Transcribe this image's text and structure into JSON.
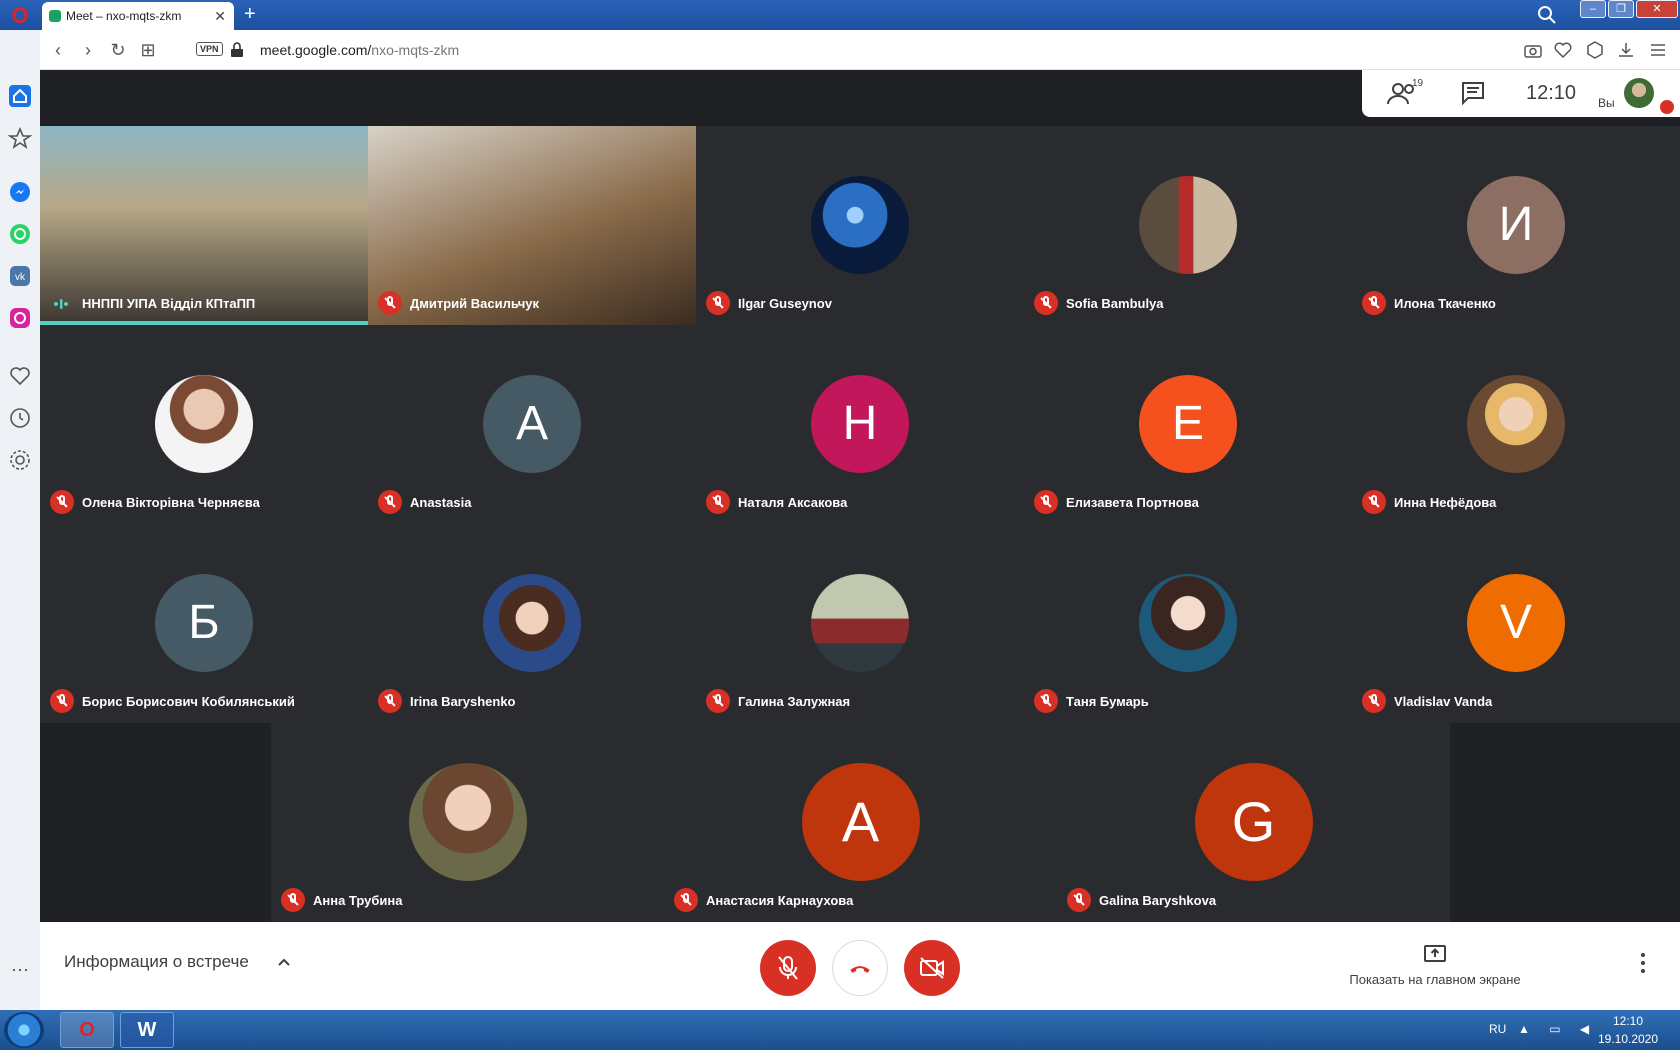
{
  "browser": {
    "tab_title": "Meet – nxo-mqts-zkm",
    "vpn_label": "VPN",
    "url_host": "meet.google.com/",
    "url_path": "nxo-mqts-zkm"
  },
  "meet": {
    "participant_count": "19",
    "time": "12:10",
    "you_label": "Вы",
    "meeting_info": "Информация о встрече",
    "present_label": "Показать на главном экране"
  },
  "participants": [
    {
      "name": "ННППІ УІПА Відділ КПтаПП",
      "type": "video"
    },
    {
      "name": "Дмитрий Васильчук",
      "type": "video"
    },
    {
      "name": "Ilgar Guseynov",
      "type": "photo"
    },
    {
      "name": "Sofia Bambulya",
      "type": "photo"
    },
    {
      "name": "Илона Ткаченко",
      "type": "initial",
      "initial": "И",
      "color": "#8d6e63"
    },
    {
      "name": "Олена Вікторівна Черняєва",
      "type": "photo"
    },
    {
      "name": "Anastasia",
      "type": "initial",
      "initial": "A",
      "color": "#455a64"
    },
    {
      "name": "Наталя Аксакова",
      "type": "initial",
      "initial": "Н",
      "color": "#c2185b"
    },
    {
      "name": "Елизавета Портнова",
      "type": "initial",
      "initial": "Е",
      "color": "#f4511e"
    },
    {
      "name": "Инна Нефёдова",
      "type": "photo"
    },
    {
      "name": "Борис Борисович Кобилянський",
      "type": "initial",
      "initial": "Б",
      "color": "#455a64"
    },
    {
      "name": "Irina Baryshenko",
      "type": "photo"
    },
    {
      "name": "Галина Залужная",
      "type": "photo"
    },
    {
      "name": "Таня Бумарь",
      "type": "photo"
    },
    {
      "name": "Vladislav Vanda",
      "type": "initial",
      "initial": "V",
      "color": "#ef6c00"
    },
    {
      "name": "Анна Трубина",
      "type": "photo"
    },
    {
      "name": "Анастасия Карнаухова",
      "type": "initial",
      "initial": "А",
      "color": "#bf360c"
    },
    {
      "name": "Galina Baryshkova",
      "type": "initial",
      "initial": "G",
      "color": "#bf360c"
    }
  ],
  "taskbar": {
    "lang": "RU",
    "time": "12:10",
    "date": "19.10.2020"
  }
}
